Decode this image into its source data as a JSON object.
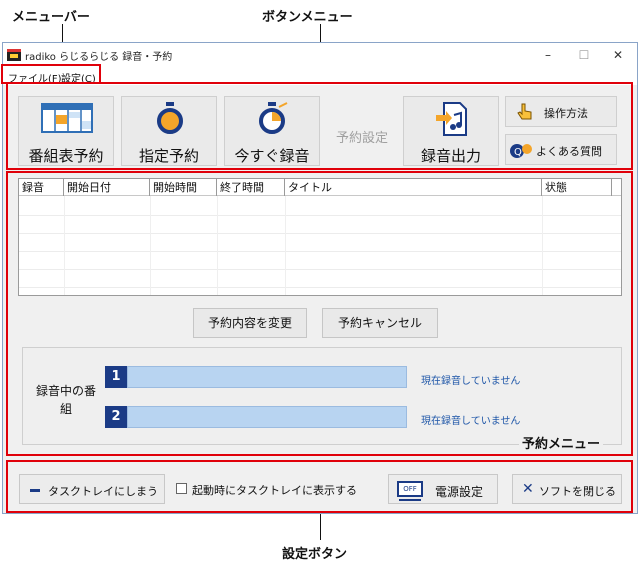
{
  "annotations": {
    "menu_bar": "メニューバー",
    "button_menu": "ボタンメニュー",
    "reserve_menu": "予約メニュー",
    "settings_buttons": "設定ボタン"
  },
  "window": {
    "title": "radiko らじるらじる 録音・予約",
    "controls": {
      "minimize": "–",
      "maximize": "☐",
      "close": "✕"
    }
  },
  "menu": [
    {
      "label": "ファイル(F)"
    },
    {
      "label": "設定(C)"
    }
  ],
  "toolbar": {
    "program_guide": "番組表予約",
    "specified_reserve": "指定予約",
    "record_now": "今すぐ録音",
    "reserve_settings": "予約設定",
    "record_output": "録音出力",
    "how_to_use": "操作方法",
    "faq": "よくある質問"
  },
  "table": {
    "columns": [
      "録音",
      "開始日付",
      "開始時間",
      "終了時間",
      "タイトル",
      "状態"
    ]
  },
  "actions": {
    "change_reservation": "予約内容を変更",
    "cancel_reservation": "予約キャンセル"
  },
  "recording": {
    "label": "録音中の番組",
    "slots": [
      {
        "number": "1",
        "status": "現在録音していません"
      },
      {
        "number": "2",
        "status": "現在録音していません"
      }
    ]
  },
  "settings": {
    "to_tray": "タスクトレイにしまう",
    "show_tray_on_start": "起動時にタスクトレイに表示する",
    "power_settings": "電源設定",
    "close_software": "ソフトを閉じる"
  },
  "colors": {
    "annotation": "#e0000a",
    "accent": "#1b3b86",
    "bar": "#b8d4f1",
    "status_text": "#1e56a8"
  }
}
